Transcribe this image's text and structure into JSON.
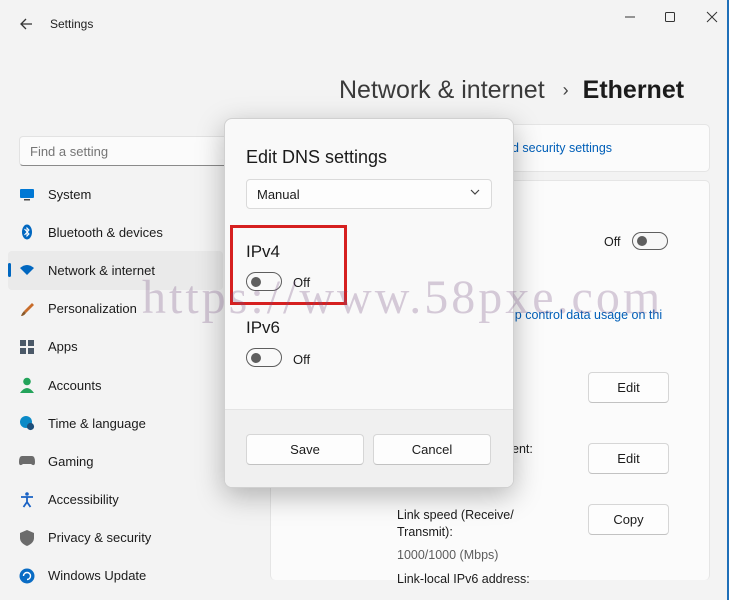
{
  "window": {
    "title": "Settings",
    "controls": {
      "minimize": "—",
      "maximize": "☐",
      "close": "✕"
    }
  },
  "breadcrumb": {
    "parent": "Network & internet",
    "separator": "›",
    "current": "Ethernet"
  },
  "search": {
    "placeholder": "Find a setting"
  },
  "sidebar": {
    "items": [
      {
        "label": "System",
        "icon": "monitor-icon",
        "color": "#0078d4"
      },
      {
        "label": "Bluetooth & devices",
        "icon": "bluetooth-icon",
        "color": "#0067c0"
      },
      {
        "label": "Network & internet",
        "icon": "wifi-icon",
        "color": "#0067c0",
        "active": true
      },
      {
        "label": "Personalization",
        "icon": "brush-icon",
        "color": "#c86c2a"
      },
      {
        "label": "Apps",
        "icon": "apps-icon",
        "color": "#4b5968"
      },
      {
        "label": "Accounts",
        "icon": "person-icon",
        "color": "#23a35a"
      },
      {
        "label": "Time & language",
        "icon": "globe-clock-icon",
        "color": "#0a8ac7"
      },
      {
        "label": "Gaming",
        "icon": "gamepad-icon",
        "color": "#6b6b6b"
      },
      {
        "label": "Accessibility",
        "icon": "accessibility-icon",
        "color": "#1a62c4"
      },
      {
        "label": "Privacy & security",
        "icon": "shield-icon",
        "color": "#6b6b6b"
      },
      {
        "label": "Windows Update",
        "icon": "update-icon",
        "color": "#0a6cc4"
      }
    ]
  },
  "content": {
    "security_link": "d security settings",
    "metered_toggle_label": "Off",
    "data_usage_link": "lp control data usage on thi",
    "edit1": "Edit",
    "row_label_partial": "ent:",
    "edit2": "Edit",
    "link_speed_label": "Link speed (Receive/",
    "link_speed_label2": "Transmit):",
    "link_speed_value": "1000/1000 (Mbps)",
    "copy": "Copy",
    "ipv6_label": "Link-local IPv6 address:"
  },
  "dialog": {
    "title": "Edit DNS settings",
    "mode": "Manual",
    "ipv4": {
      "heading": "IPv4",
      "toggle_label": "Off",
      "enabled": false
    },
    "ipv6": {
      "heading": "IPv6",
      "toggle_label": "Off",
      "enabled": false
    },
    "save": "Save",
    "cancel": "Cancel"
  },
  "watermark": "https://www.58pxe.com",
  "colors": {
    "accent": "#0067c0",
    "highlight": "#d62020",
    "link": "#005fb8"
  }
}
